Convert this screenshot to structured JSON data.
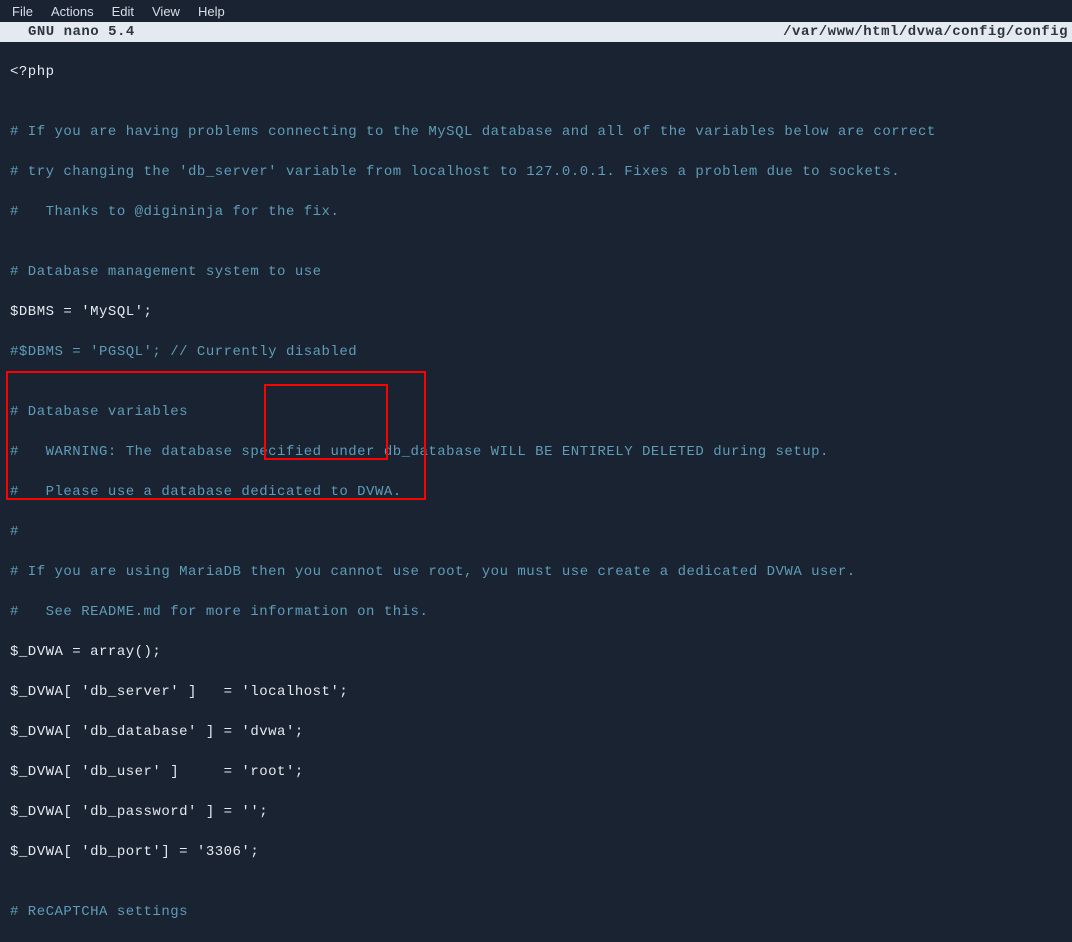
{
  "menubar": {
    "items": [
      "File",
      "Actions",
      "Edit",
      "View",
      "Help"
    ]
  },
  "nano": {
    "app": "GNU nano 5.4",
    "filepath": "/var/www/html/dvwa/config/config"
  },
  "lines": {
    "l0": "<?php",
    "l1": "",
    "l2": "# If you are having problems connecting to the MySQL database and all of the variables below are correct",
    "l3": "# try changing the 'db_server' variable from localhost to 127.0.0.1. Fixes a problem due to sockets.",
    "l4": "#   Thanks to @digininja for the fix.",
    "l5": "",
    "l6": "# Database management system to use",
    "l7": "$DBMS = 'MySQL';",
    "l8": "#$DBMS = 'PGSQL'; // Currently disabled",
    "l9": "",
    "l10": "# Database variables",
    "l11": "#   WARNING: The database specified under db_database WILL BE ENTIRELY DELETED during setup.",
    "l12": "#   Please use a database dedicated to DVWA.",
    "l13": "#",
    "l14": "# If you are using MariaDB then you cannot use root, you must use create a dedicated DVWA user.",
    "l15": "#   See README.md for more information on this.",
    "l16": "$_DVWA = array();",
    "l17": "$_DVWA[ 'db_server' ]   = 'localhost';",
    "l18": "$_DVWA[ 'db_database' ] = 'dvwa';",
    "l19": "$_DVWA[ 'db_user' ]     = 'root';",
    "l20": "$_DVWA[ 'db_password' ] = '';",
    "l21": "$_DVWA[ 'db_port'] = '3306';",
    "l22": "",
    "l23": "# ReCAPTCHA settings"
  }
}
